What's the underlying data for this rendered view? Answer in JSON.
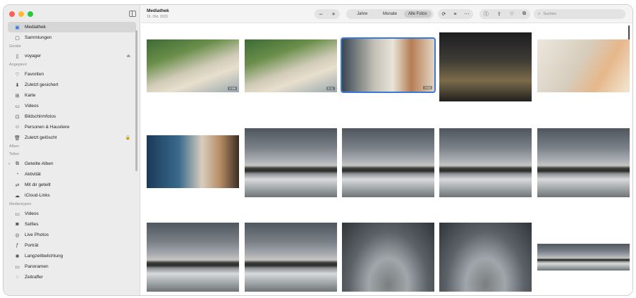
{
  "sidebar": {
    "top_items": [
      {
        "label": "Mediathek",
        "icon": "photo-library-icon",
        "active": true
      },
      {
        "label": "Sammlungen",
        "icon": "collections-icon"
      }
    ],
    "sections": [
      {
        "title": "Geräte",
        "items": [
          {
            "label": "voyager",
            "icon": "device-icon",
            "eject": true
          }
        ]
      },
      {
        "title": "Angepinnt",
        "items": [
          {
            "label": "Favoriten",
            "icon": "heart-icon"
          },
          {
            "label": "Zuletzt gesichert",
            "icon": "saved-icon"
          },
          {
            "label": "Karte",
            "icon": "map-icon"
          },
          {
            "label": "Videos",
            "icon": "video-icon"
          },
          {
            "label": "Bildschirmfotos",
            "icon": "screenshot-icon"
          },
          {
            "label": "Personen & Haustiere",
            "icon": "people-icon"
          },
          {
            "label": "Zuletzt gelöscht",
            "icon": "trash-icon",
            "lock": true
          }
        ]
      },
      {
        "title": "Alben",
        "items": []
      },
      {
        "title": "Teilen",
        "items": [
          {
            "label": "Geteilte Alben",
            "icon": "shared-albums-icon",
            "chevron": true
          },
          {
            "label": "Aktivität",
            "icon": "activity-icon"
          },
          {
            "label": "Mit dir geteilt",
            "icon": "shared-with-you-icon"
          },
          {
            "label": "iCloud-Links",
            "icon": "icloud-link-icon"
          }
        ]
      },
      {
        "title": "Medientypen",
        "items": [
          {
            "label": "Videos",
            "icon": "video-icon"
          },
          {
            "label": "Selfies",
            "icon": "selfie-icon"
          },
          {
            "label": "Live Photos",
            "icon": "live-photo-icon"
          },
          {
            "label": "Porträt",
            "icon": "portrait-icon"
          },
          {
            "label": "Langzeitbelichtung",
            "icon": "long-exposure-icon"
          },
          {
            "label": "Panoramen",
            "icon": "panorama-icon"
          },
          {
            "label": "Zeitraffer",
            "icon": "timelapse-icon"
          }
        ]
      }
    ]
  },
  "toolbar": {
    "title": "Mediathek",
    "subtitle": "16. Okt. 2023",
    "zoom_out": "−",
    "zoom_in": "+",
    "view_tabs": [
      "Jahre",
      "Monate",
      "Alle Fotos"
    ],
    "selected_tab": "Alle Fotos",
    "search_placeholder": "Suchen"
  },
  "photos": [
    {
      "scene": "garden",
      "duration": "0:08"
    },
    {
      "scene": "garden",
      "duration": "0:11"
    },
    {
      "scene": "shop",
      "duration": "0:02",
      "selected": true
    },
    {
      "scene": "bar"
    },
    {
      "scene": "room"
    },
    {
      "scene": "coffee"
    },
    {
      "scene": "sky-city"
    },
    {
      "scene": "sky-city"
    },
    {
      "scene": "sky-city"
    },
    {
      "scene": "sky-city"
    },
    {
      "scene": "sky-city"
    },
    {
      "scene": "sky-city"
    },
    {
      "scene": "sky-fish"
    },
    {
      "scene": "sky-fish"
    },
    {
      "scene": "sky-city"
    }
  ],
  "colors": {
    "accent": "#3a79d8",
    "close": "#fe5f57",
    "minimize": "#febc2e",
    "zoom": "#28c840"
  }
}
